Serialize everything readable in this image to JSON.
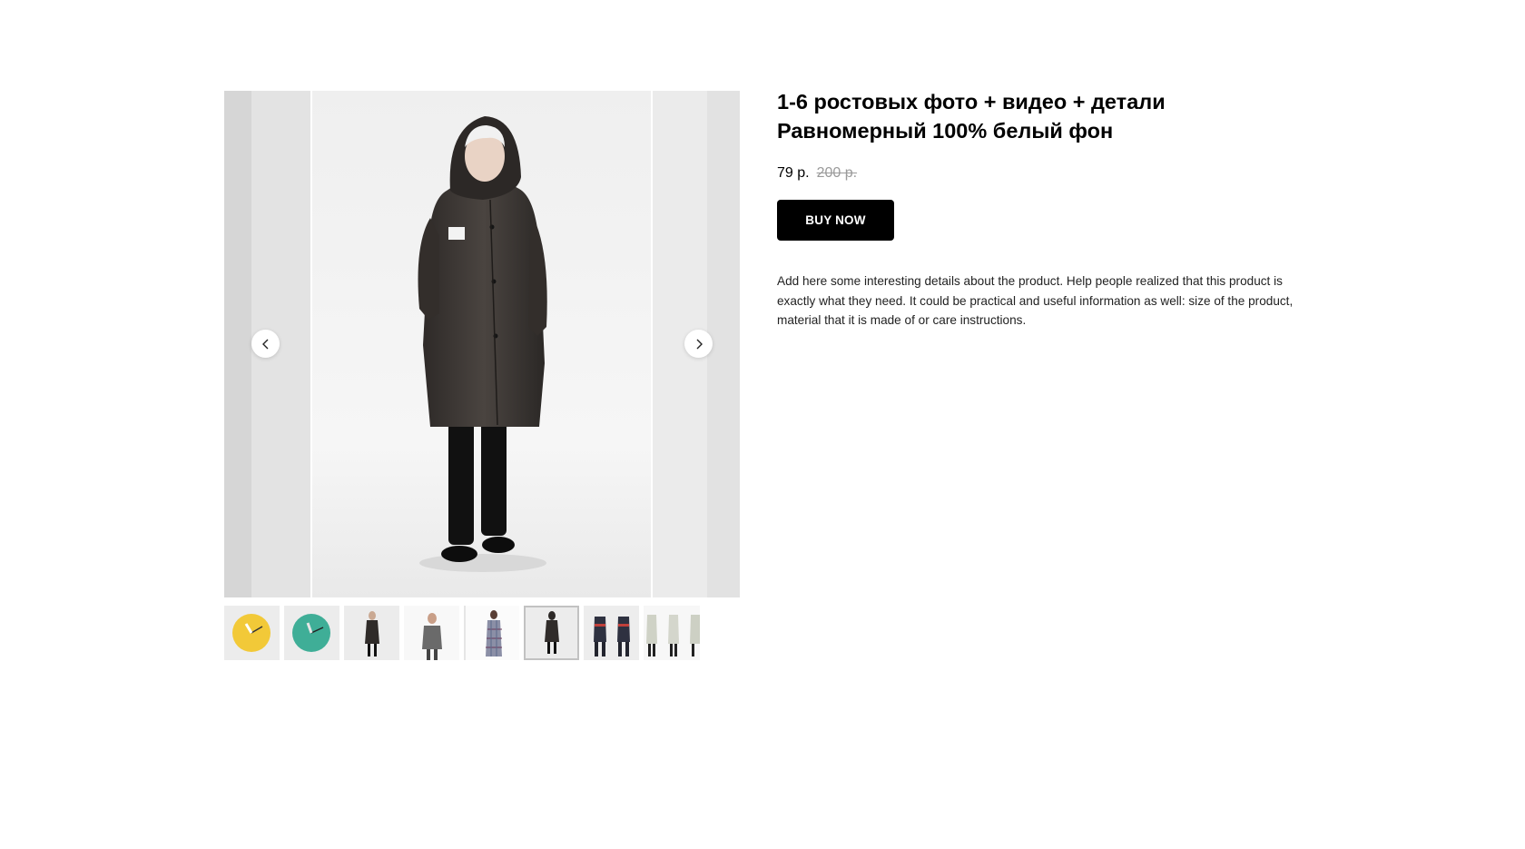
{
  "product": {
    "title_line1": "1-6 ростовых фото + видео + детали",
    "title_line2": "Равномерный 100% белый фон",
    "price": "79 р.",
    "price_old": "200 р.",
    "buy_label": "BUY NOW",
    "description": "Add here some interesting details about the product. Help people realized that this product is exactly what they need. It could be practical and useful information as well: size of the product, material that it is made of or care instructions."
  },
  "gallery": {
    "thumbnails": [
      {
        "name": "thumb-yellow-clock",
        "color": "#f2c938",
        "active": false
      },
      {
        "name": "thumb-teal-clock",
        "color": "#3fae97",
        "active": false
      },
      {
        "name": "thumb-dark-coat",
        "active": false
      },
      {
        "name": "thumb-gray-jacket",
        "active": false
      },
      {
        "name": "thumb-plaid-coat",
        "active": false
      },
      {
        "name": "thumb-hooded-coat",
        "active": true
      },
      {
        "name": "thumb-workwear",
        "active": false
      },
      {
        "name": "thumb-light-coats",
        "active": false
      }
    ]
  },
  "colors": {
    "button_bg": "#000000",
    "old_price": "#9a9a9a",
    "slide_bg": "#efefef"
  }
}
